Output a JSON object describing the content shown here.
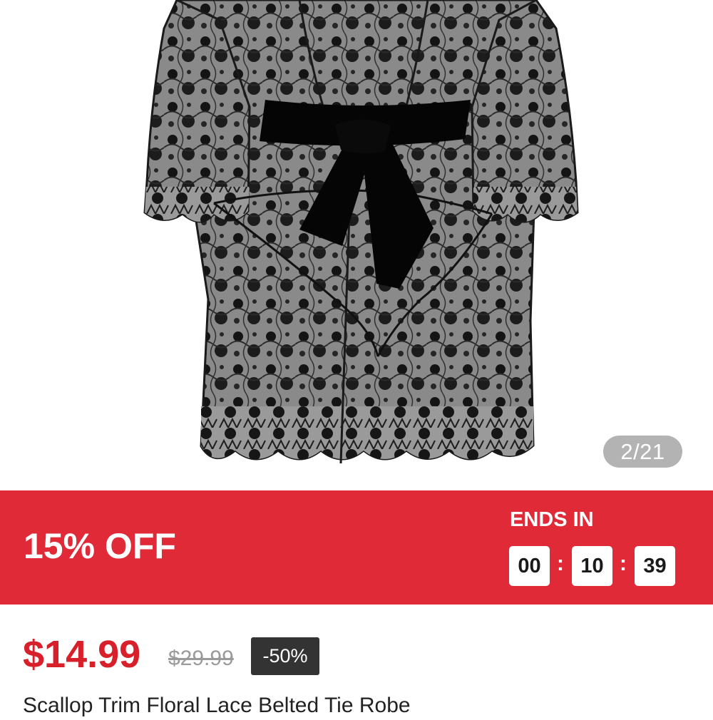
{
  "gallery": {
    "current_index": "2/21",
    "image_icon": "lace-robe-image"
  },
  "sale": {
    "title": "15% OFF",
    "ends_label": "ENDS IN",
    "hours": "00",
    "minutes": "10",
    "seconds": "39",
    "separator": ":",
    "background_color": "#e02a38"
  },
  "price": {
    "current": "$14.99",
    "original": "$29.99",
    "discount": "-50%",
    "accent_color": "#d8202b"
  },
  "product": {
    "title": "Scallop Trim Floral Lace Belted Tie Robe"
  }
}
